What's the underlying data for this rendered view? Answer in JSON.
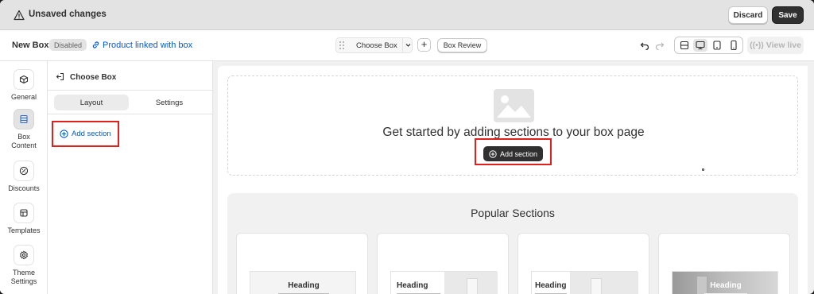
{
  "topbar": {
    "title": "Unsaved changes",
    "discard": "Discard",
    "save": "Save"
  },
  "toolbar": {
    "box_name": "New Box",
    "status_badge": "Disabled",
    "product_link": "Product linked with box",
    "page_select": "Choose Box",
    "add": "+",
    "box_review": "Box Review",
    "view_live": "View live",
    "active_device": "desktop"
  },
  "rail": {
    "items": [
      {
        "label": "General",
        "icon": "box-icon"
      },
      {
        "label": "Box\nContent",
        "icon": "layout-icon"
      },
      {
        "label": "Discounts",
        "icon": "discount-icon"
      },
      {
        "label": "Templates",
        "icon": "template-icon"
      },
      {
        "label": "Theme\nSettings",
        "icon": "gear-icon"
      }
    ]
  },
  "panel": {
    "title": "Choose Box",
    "tabs": [
      "Layout",
      "Settings"
    ],
    "add_section": "Add section"
  },
  "canvas": {
    "empty_text": "Get started by adding sections to your box page",
    "add_section": "Add section",
    "popular_title": "Popular Sections",
    "cards": [
      {
        "heading": "Heading"
      },
      {
        "heading": "Heading"
      },
      {
        "heading": "Heading"
      },
      {
        "heading": "Heading"
      }
    ]
  },
  "colors": {
    "link": "#005bd3",
    "primary": "#303030",
    "highlight": "#e0201c"
  }
}
